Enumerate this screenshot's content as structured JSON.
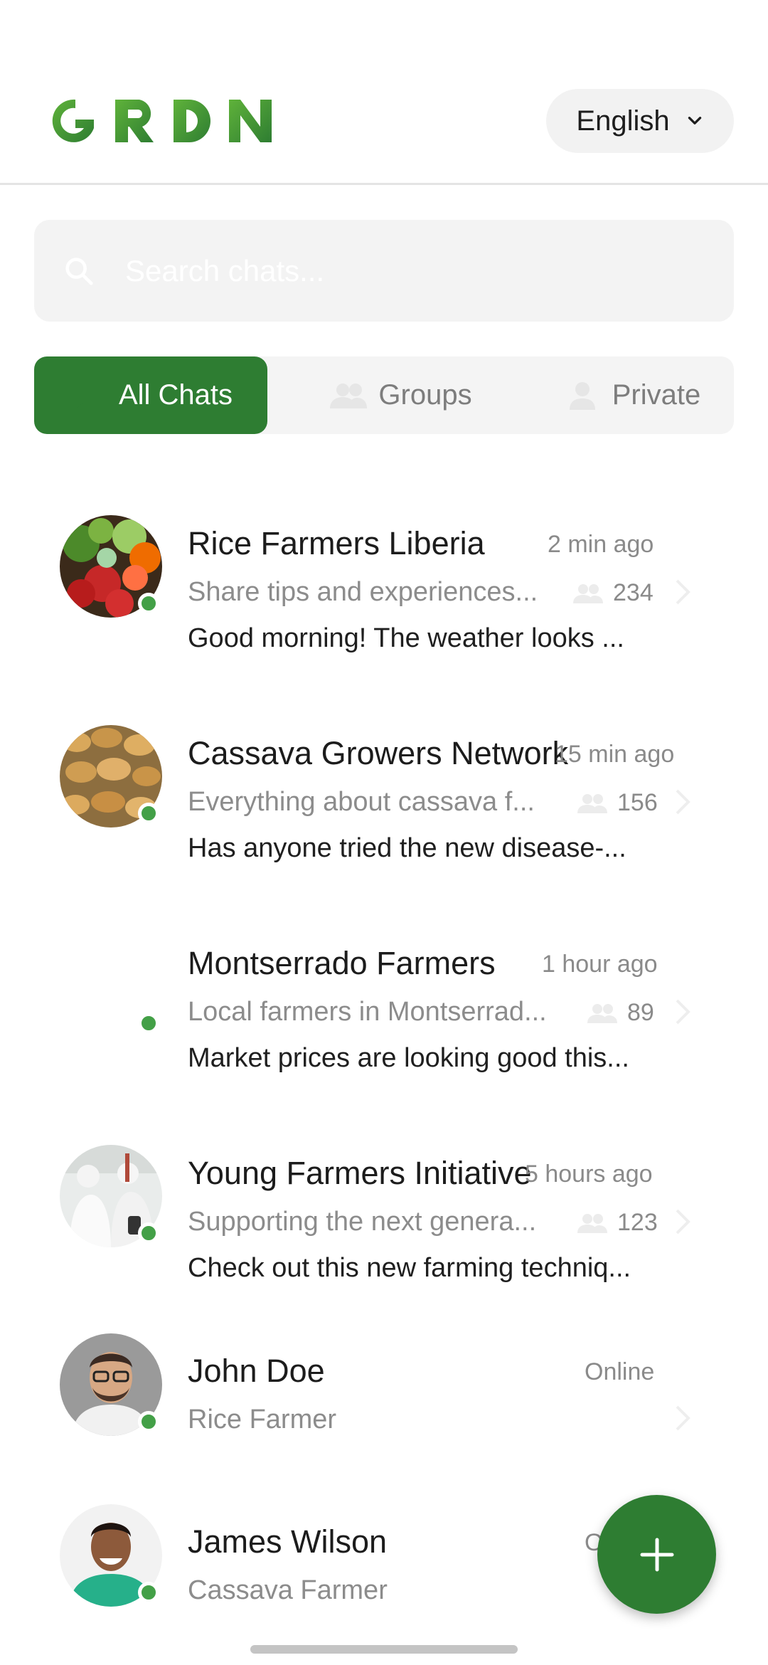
{
  "app": {
    "logo_text": "GRDN",
    "language": "English"
  },
  "search": {
    "placeholder": "Search chats..."
  },
  "tabs": [
    {
      "label": "All Chats",
      "active": true
    },
    {
      "label": "Groups",
      "active": false
    },
    {
      "label": "Private",
      "active": false
    }
  ],
  "chats": [
    {
      "name": "Rice Farmers Liberia",
      "time": "2 min ago",
      "description": "Share tips and experiences...",
      "members": "234",
      "last_message": "Good morning! The weather looks ...",
      "online": true,
      "avatar": "vegetables"
    },
    {
      "name": "Cassava Growers Network",
      "time": "15 min ago",
      "description": "Everything about cassava f...",
      "members": "156",
      "last_message": "Has anyone tried the new disease-...",
      "online": true,
      "avatar": "potatoes"
    },
    {
      "name": "Montserrado Farmers",
      "time": "1 hour ago",
      "description": "Local farmers in Montserrad...",
      "members": "89",
      "last_message": "Market prices are looking good this...",
      "online": true,
      "avatar": "none"
    },
    {
      "name": "Young Farmers Initiative",
      "time": "5 hours ago",
      "description": "Supporting the next genera...",
      "members": "123",
      "last_message": "Check out this new farming techniq...",
      "online": true,
      "avatar": "lab"
    },
    {
      "name": "John Doe",
      "time": "Online",
      "description": "Rice Farmer",
      "online": true,
      "avatar": "man-glasses"
    },
    {
      "name": "James Wilson",
      "time": "O",
      "description": "Cassava Farmer",
      "online": true,
      "avatar": "man-green-shirt"
    }
  ],
  "colors": {
    "brand": "#2e7d32",
    "online": "#43a047"
  },
  "icons": {
    "search": "search-icon",
    "chevron": "chevron-down-icon",
    "members": "people-icon",
    "person": "person-icon",
    "add": "plus-icon"
  }
}
